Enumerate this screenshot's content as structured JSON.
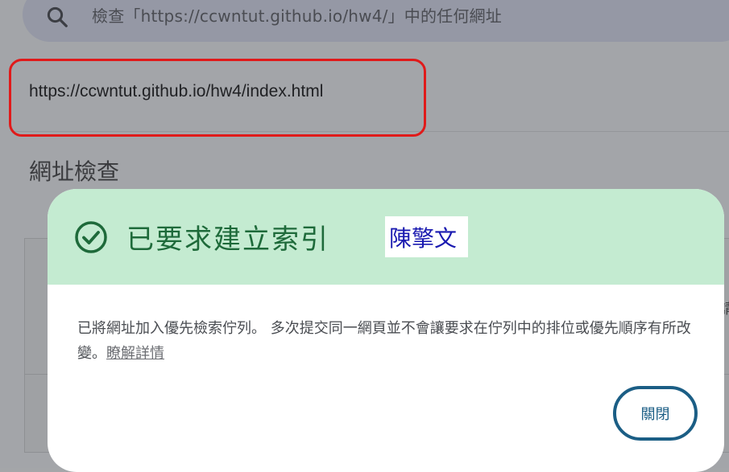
{
  "search": {
    "placeholder_text": "檢查「https://ccwntut.github.io/hw4/」中的任何網址",
    "icon": "search-icon"
  },
  "url_row": {
    "url": "https://ccwntut.github.io/hw4/index.html"
  },
  "section": {
    "title": "網址檢查",
    "edge_char": "請"
  },
  "dialog": {
    "title": "已要求建立索引",
    "name_label": "陳擎文",
    "message": "已將網址加入優先檢索佇列。 多次提交同一網頁並不會讓要求在佇列中的排位或優先順序有所改變。",
    "learn_more": "瞭解詳情",
    "close_label": "關閉",
    "status_icon": "check-circle-icon",
    "colors": {
      "header_bg": "#c4ebd1",
      "title": "#1e6a3a",
      "close": "#1b5e85",
      "highlight_border": "#e01a1a"
    }
  }
}
